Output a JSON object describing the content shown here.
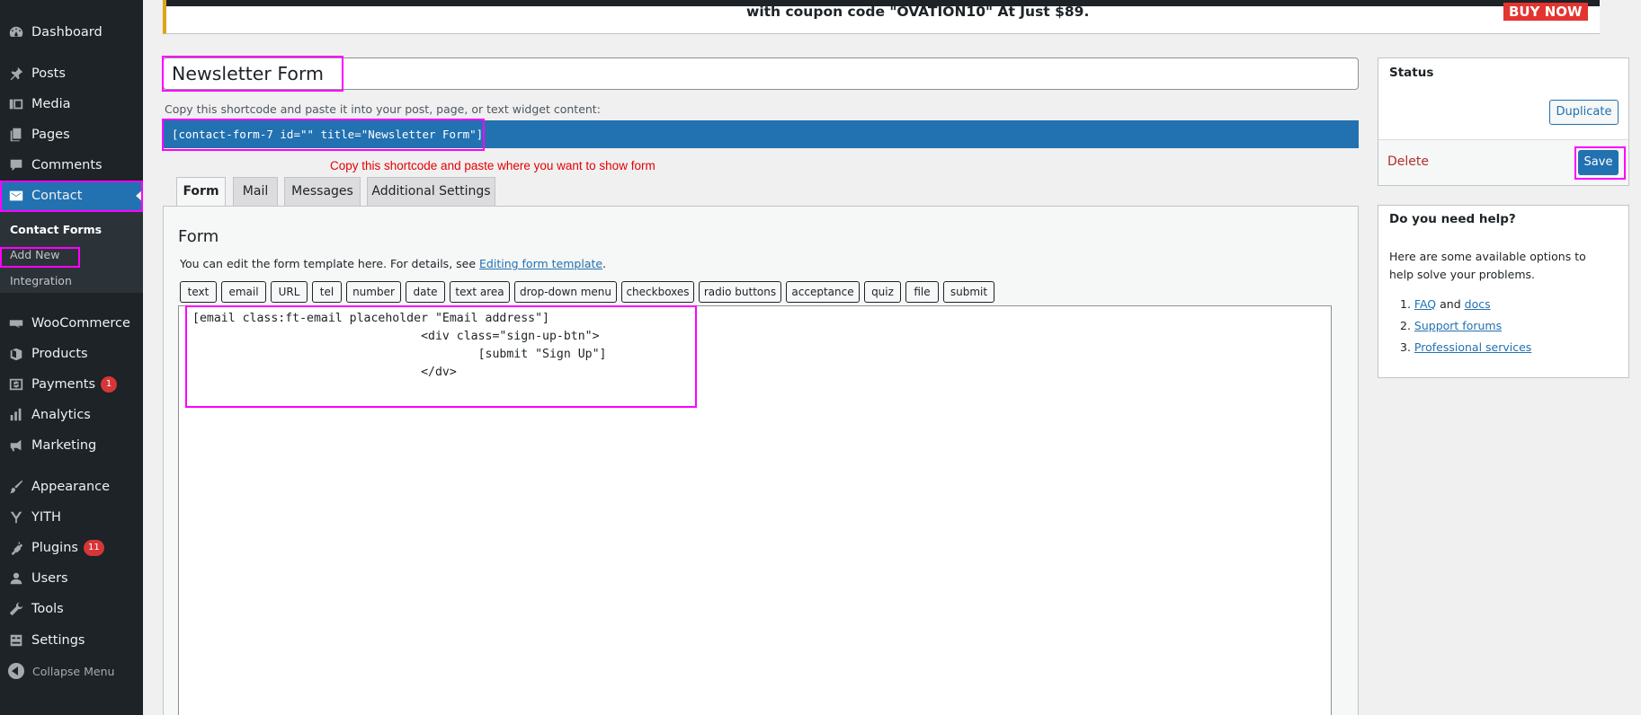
{
  "sidebar": {
    "items": [
      {
        "label": "Dashboard",
        "icon": "dashboard-icon"
      },
      {
        "label": "Posts",
        "icon": "pin-icon"
      },
      {
        "label": "Media",
        "icon": "media-icon"
      },
      {
        "label": "Pages",
        "icon": "pages-icon"
      },
      {
        "label": "Comments",
        "icon": "comment-icon"
      },
      {
        "label": "Contact",
        "icon": "envelope-icon"
      },
      {
        "label": "WooCommerce",
        "icon": "woocommerce-icon"
      },
      {
        "label": "Products",
        "icon": "box-icon"
      },
      {
        "label": "Payments",
        "icon": "dollar-icon",
        "badge": "1"
      },
      {
        "label": "Analytics",
        "icon": "bar-chart-icon"
      },
      {
        "label": "Marketing",
        "icon": "megaphone-icon"
      },
      {
        "label": "Appearance",
        "icon": "brush-icon"
      },
      {
        "label": "YITH",
        "icon": "yith-icon"
      },
      {
        "label": "Plugins",
        "icon": "plugin-icon",
        "badge": "11"
      },
      {
        "label": "Users",
        "icon": "user-icon"
      },
      {
        "label": "Tools",
        "icon": "wrench-icon"
      },
      {
        "label": "Settings",
        "icon": "settings-icon"
      }
    ],
    "submenu": [
      "Contact Forms",
      "Add New",
      "Integration"
    ],
    "collapse_label": "Collapse Menu"
  },
  "banner": {
    "text": "with coupon code \"OVATION10\" At Just $89.",
    "buy_now": "BUY NOW"
  },
  "editor": {
    "title_value": "Newsletter Form",
    "shortcode_desc": "Copy this shortcode and paste it into your post, page, or text widget content:",
    "shortcode": "[contact-form-7 id=\"\" title=\"Newsletter Form\"]",
    "annotation": "Copy this shortcode and paste where you want to show form",
    "tabs": [
      "Form",
      "Mail",
      "Messages",
      "Additional Settings"
    ],
    "form_heading": "Form",
    "form_desc_prefix": "You can edit the form template here. For details, see ",
    "form_desc_link": "Editing form template",
    "form_desc_suffix": ".",
    "tag_buttons": [
      "text",
      "email",
      "URL",
      "tel",
      "number",
      "date",
      "text area",
      "drop-down menu",
      "checkboxes",
      "radio buttons",
      "acceptance",
      "quiz",
      "file",
      "submit"
    ],
    "code": "[email class:ft-email placeholder \"Email address\"]\n                                <div class=\"sign-up-btn\">\n                                        [submit \"Sign Up\"]\n                                </dv>"
  },
  "status": {
    "title": "Status",
    "duplicate": "Duplicate",
    "delete": "Delete",
    "save": "Save"
  },
  "help": {
    "title": "Do you need help?",
    "text": "Here are some available options to help solve your problems.",
    "item1_num": "1.",
    "item1_link_a": "FAQ",
    "item1_and": "and",
    "item1_link_b": "docs",
    "item2_num": "2.",
    "item2_link": "Support forums",
    "item3_num": "3.",
    "item3_link": "Professional services"
  },
  "colors": {
    "sidebar_bg": "#1d2327",
    "accent": "#2271b1",
    "highlight": "#ff00ff",
    "annotation": "#e60000",
    "delete": "#b32d2e"
  }
}
